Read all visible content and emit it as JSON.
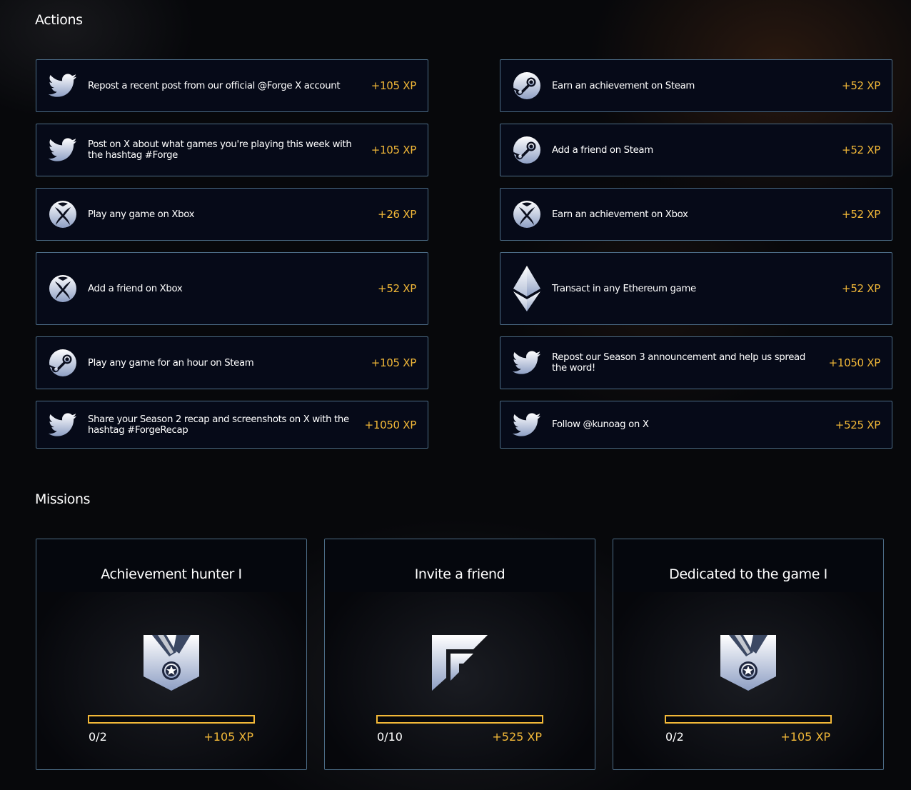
{
  "actions": {
    "title": "Actions",
    "left": [
      {
        "icon": "twitter-icon",
        "text": "Repost a recent post from our official @Forge X account",
        "xp": "+105 XP"
      },
      {
        "icon": "twitter-icon",
        "text": "Post on X about what games you're playing this week with the hashtag #Forge",
        "xp": "+105 XP"
      },
      {
        "icon": "xbox-icon",
        "text": "Play any game on Xbox",
        "xp": "+26 XP"
      },
      {
        "icon": "xbox-icon",
        "text": "Add a friend on Xbox",
        "xp": "+52 XP"
      },
      {
        "icon": "steam-icon",
        "text": "Play any game for an hour on Steam",
        "xp": "+105 XP"
      },
      {
        "icon": "twitter-icon",
        "text": "Share your Season 2 recap and screenshots on X with the hashtag #ForgeRecap",
        "xp": "+1050 XP"
      }
    ],
    "right": [
      {
        "icon": "steam-icon",
        "text": "Earn an achievement on Steam",
        "xp": "+52 XP"
      },
      {
        "icon": "steam-icon",
        "text": "Add a friend on Steam",
        "xp": "+52 XP"
      },
      {
        "icon": "xbox-icon",
        "text": "Earn an achievement on Xbox",
        "xp": "+52 XP"
      },
      {
        "icon": "ethereum-icon",
        "text": "Transact in any Ethereum game",
        "xp": "+52 XP"
      },
      {
        "icon": "twitter-icon",
        "text": "Repost our Season 3 announcement and help us spread the word!",
        "xp": "+1050 XP"
      },
      {
        "icon": "twitter-icon",
        "text": "Follow @kunoag on X",
        "xp": "+525 XP"
      }
    ]
  },
  "missions": {
    "title": "Missions",
    "items": [
      {
        "title": "Achievement hunter I",
        "emblem": "medal-icon",
        "progress": "0/2",
        "progress_fraction": 0,
        "xp": "+105 XP"
      },
      {
        "title": "Invite a friend",
        "emblem": "forge-logo-icon",
        "progress": "0/10",
        "progress_fraction": 0,
        "xp": "+525 XP"
      },
      {
        "title": "Dedicated to the game I",
        "emblem": "medal-icon",
        "progress": "0/2",
        "progress_fraction": 0,
        "xp": "+105 XP"
      }
    ]
  },
  "colors": {
    "accent_xp": "#f2b838",
    "card_border": "#4c6c86",
    "card_bg": "#060a18",
    "background": "#07080b"
  }
}
